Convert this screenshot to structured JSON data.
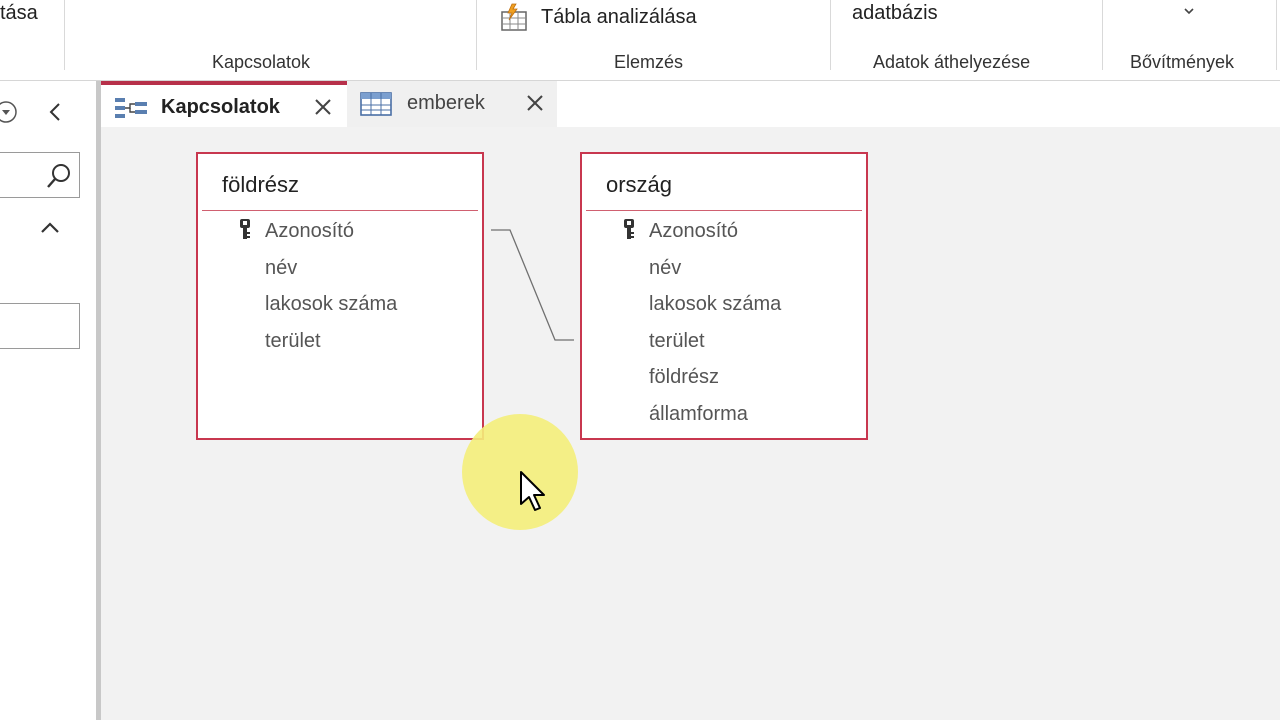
{
  "ribbon": {
    "cut_text_left": "tása",
    "analyze_table": "Tábla analizálása",
    "database_text": "adatbázis",
    "groups": {
      "relationships": "Kapcsolatok",
      "analyze": "Elemzés",
      "move_data": "Adatok áthelyezése",
      "addins": "Bővítmények"
    }
  },
  "tabs": [
    {
      "label": "Kapcsolatok",
      "active": true
    },
    {
      "label": "emberek",
      "active": false
    }
  ],
  "tables": [
    {
      "title": "földrész",
      "fields": [
        {
          "name": "Azonosító",
          "primary_key": true
        },
        {
          "name": "név",
          "primary_key": false
        },
        {
          "name": "lakosok száma",
          "primary_key": false
        },
        {
          "name": "terület",
          "primary_key": false
        }
      ]
    },
    {
      "title": "ország",
      "fields": [
        {
          "name": "Azonosító",
          "primary_key": true
        },
        {
          "name": "név",
          "primary_key": false
        },
        {
          "name": "lakosok száma",
          "primary_key": false
        },
        {
          "name": "terület",
          "primary_key": false
        },
        {
          "name": "földrész",
          "primary_key": false
        },
        {
          "name": "államforma",
          "primary_key": false
        }
      ]
    }
  ],
  "relationship": {
    "from_table": "földrész",
    "from_field": "Azonosító",
    "to_table": "ország",
    "to_field": "földrész"
  },
  "colors": {
    "accent": "#b7304a",
    "table_border": "#c8374f",
    "canvas_bg": "#f2f2f2",
    "cursor_highlight": "#f4ee7a"
  }
}
